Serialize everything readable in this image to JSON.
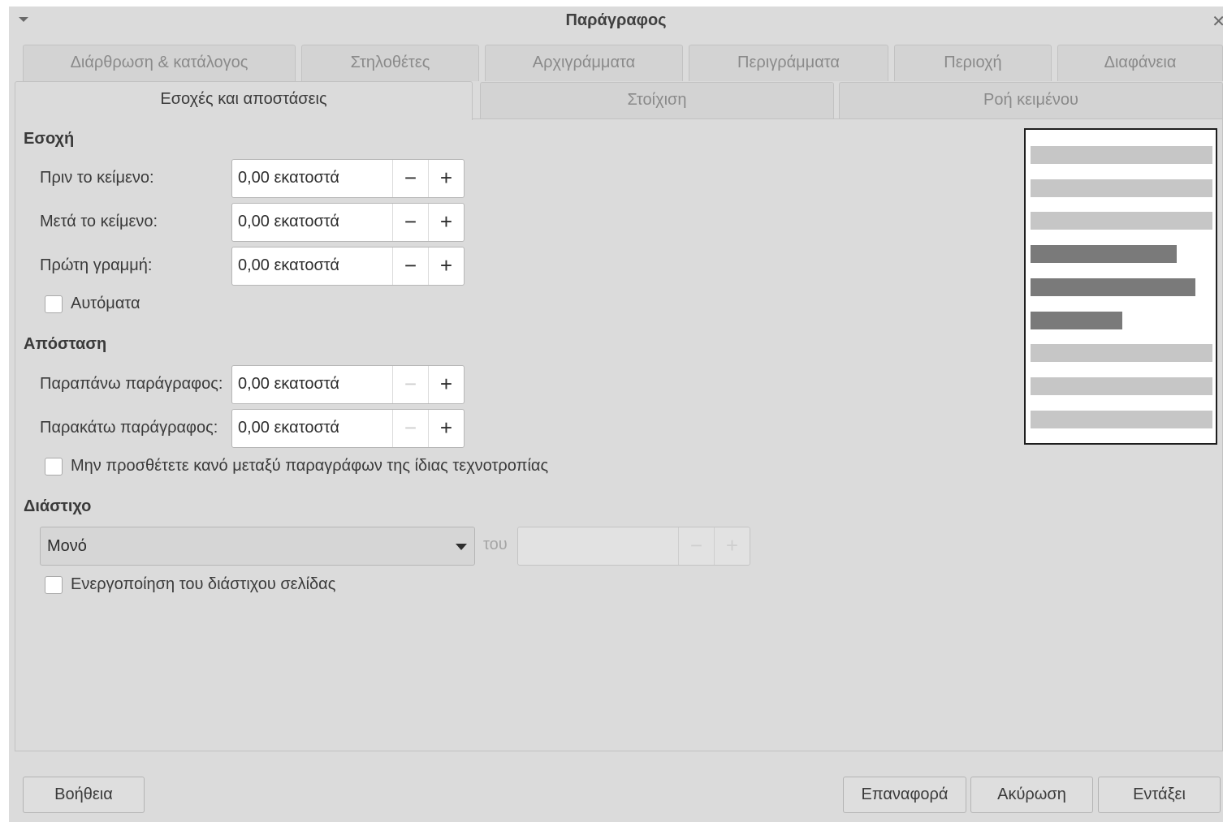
{
  "window": {
    "title": "Παράγραφος"
  },
  "tabs": {
    "row1": [
      "Διάρθρωση & κατάλογος",
      "Στηλοθέτες",
      "Αρχιγράμματα",
      "Περιγράμματα",
      "Περιοχή",
      "Διαφάνεια"
    ],
    "row2": [
      "Εσοχές και αποστάσεις",
      "Στοίχιση",
      "Ροή κειμένου"
    ],
    "active": "Εσοχές και αποστάσεις"
  },
  "indent": {
    "heading": "Εσοχή",
    "before_label": "Πριν το κείμενο:",
    "before_value": "0,00 εκατοστά",
    "after_label": "Μετά το κείμενο:",
    "after_value": "0,00 εκατοστά",
    "first_line_label": "Πρώτη γραμμή:",
    "first_line_value": "0,00 εκατοστά",
    "automatic_label": "Αυτόματα",
    "automatic_checked": false
  },
  "spacing": {
    "heading": "Απόσταση",
    "above_label": "Παραπάνω παράγραφος:",
    "above_value": "0,00 εκατοστά",
    "below_label": "Παρακάτω παράγραφος:",
    "below_value": "0,00 εκατοστά",
    "no_space_label": "Μην προσθέτετε κανό μεταξύ παραγράφων της ίδιας τεχνοτροπίας",
    "no_space_checked": false
  },
  "line_spacing": {
    "heading": "Διάστιχο",
    "selected": "Μονό",
    "of_label": "του",
    "of_value": "",
    "register_label": "Ενεργοποίηση του διάστιχου σελίδας",
    "register_checked": false
  },
  "spin_symbols": {
    "minus": "−",
    "plus": "+"
  },
  "icons": {
    "menu": "menu-arrow-icon",
    "close": "close-icon",
    "dropdown": "chevron-down-icon"
  },
  "buttons": {
    "help": "Βοήθεια",
    "reset": "Επαναφορά",
    "cancel": "Ακύρωση",
    "ok": "Εντάξει"
  }
}
